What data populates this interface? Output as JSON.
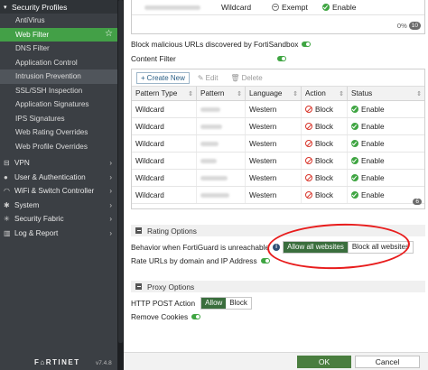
{
  "sidebar": {
    "header": "Security Profiles",
    "items": [
      {
        "label": "AntiVirus"
      },
      {
        "label": "Web Filter"
      },
      {
        "label": "DNS Filter"
      },
      {
        "label": "Application Control"
      },
      {
        "label": "Intrusion Prevention"
      },
      {
        "label": "SSL/SSH Inspection"
      },
      {
        "label": "Application Signatures"
      },
      {
        "label": "IPS Signatures"
      },
      {
        "label": "Web Rating Overrides"
      },
      {
        "label": "Web Profile Overrides"
      }
    ],
    "top_items": [
      {
        "label": "VPN",
        "icon": "lock-icon"
      },
      {
        "label": "User & Authentication",
        "icon": "user-icon"
      },
      {
        "label": "WiFi & Switch Controller",
        "icon": "wifi-icon"
      },
      {
        "label": "System",
        "icon": "gear-icon"
      },
      {
        "label": "Security Fabric",
        "icon": "fabric-icon"
      },
      {
        "label": "Log & Report",
        "icon": "chart-icon"
      }
    ],
    "logo": "F⌂RTINET",
    "version": "v7.4.8"
  },
  "top_table": {
    "type": "Wildcard",
    "action": "Exempt",
    "status": "Enable",
    "count_text": "0%",
    "count_badge": "10"
  },
  "options": {
    "block_malicious": "Block malicious URLs discovered by FortiSandbox",
    "content_filter": "Content Filter"
  },
  "toolbar": {
    "create": "Create New",
    "edit": "Edit",
    "delete": "Delete"
  },
  "table": {
    "headers": [
      "Pattern Type",
      "Pattern",
      "Language",
      "Action",
      "Status"
    ],
    "rows": [
      {
        "type": "Wildcard",
        "language": "Western",
        "action": "Block",
        "status": "Enable"
      },
      {
        "type": "Wildcard",
        "language": "Western",
        "action": "Block",
        "status": "Enable"
      },
      {
        "type": "Wildcard",
        "language": "Western",
        "action": "Block",
        "status": "Enable"
      },
      {
        "type": "Wildcard",
        "language": "Western",
        "action": "Block",
        "status": "Enable"
      },
      {
        "type": "Wildcard",
        "language": "Western",
        "action": "Block",
        "status": "Enable"
      },
      {
        "type": "Wildcard",
        "language": "Western",
        "action": "Block",
        "status": "Enable"
      }
    ],
    "count_badge": "6"
  },
  "rating": {
    "title": "Rating Options",
    "fortiguard_label": "Behavior when FortiGuard is unreachable",
    "allow": "Allow all websites",
    "block": "Block all websites",
    "rate_urls": "Rate URLs by domain and IP Address"
  },
  "proxy": {
    "title": "Proxy Options",
    "http_post": "HTTP POST Action",
    "allow": "Allow",
    "block": "Block",
    "remove_cookies": "Remove Cookies"
  },
  "footer": {
    "ok": "OK",
    "cancel": "Cancel"
  },
  "colors": {
    "accent": "#43a047",
    "sidebar": "#3b3f44",
    "annotation": "#e81c1c"
  }
}
